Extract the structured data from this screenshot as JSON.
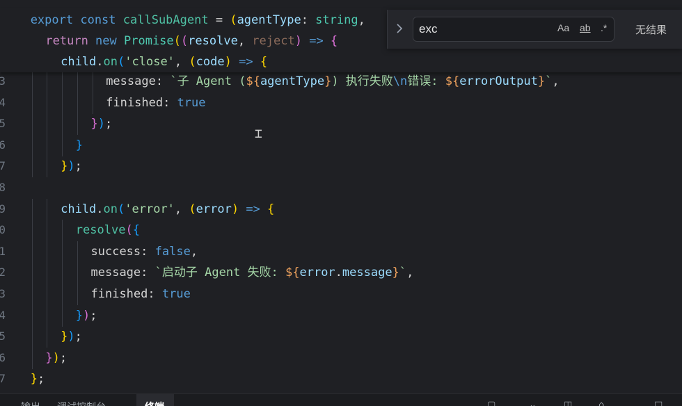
{
  "sticky": [
    {
      "indent": 2,
      "tokens": [
        {
          "t": "export ",
          "c": "kw2"
        },
        {
          "t": "const ",
          "c": "kw2"
        },
        {
          "t": "callSubAgent",
          "c": "fn"
        },
        {
          "t": " = ",
          "c": "plain"
        },
        {
          "t": "(",
          "c": "b1"
        },
        {
          "t": "agentType",
          "c": "var"
        },
        {
          "t": ": ",
          "c": "plain"
        },
        {
          "t": "string",
          "c": "type"
        },
        {
          "t": ",",
          "c": "plain"
        }
      ]
    },
    {
      "indent": 3,
      "tokens": [
        {
          "t": "return ",
          "c": "kw"
        },
        {
          "t": "new ",
          "c": "kw2"
        },
        {
          "t": "Promise",
          "c": "type"
        },
        {
          "t": "(",
          "c": "b1"
        },
        {
          "t": "(",
          "c": "b2"
        },
        {
          "t": "resolve",
          "c": "var"
        },
        {
          "t": ", ",
          "c": "plain"
        },
        {
          "t": "reject",
          "c": "dim"
        },
        {
          "t": ") ",
          "c": "b2"
        },
        {
          "t": "=> ",
          "c": "kw2"
        },
        {
          "t": "{",
          "c": "b2"
        }
      ]
    },
    {
      "indent": 4,
      "tokens": [
        {
          "t": "child",
          "c": "var"
        },
        {
          "t": ".",
          "c": "plain"
        },
        {
          "t": "on",
          "c": "fn"
        },
        {
          "t": "(",
          "c": "b3"
        },
        {
          "t": "'close'",
          "c": "strc"
        },
        {
          "t": ", ",
          "c": "plain"
        },
        {
          "t": "(",
          "c": "b1"
        },
        {
          "t": "code",
          "c": "var"
        },
        {
          "t": ") ",
          "c": "b1"
        },
        {
          "t": "=> ",
          "c": "kw2"
        },
        {
          "t": "{",
          "c": "b1"
        }
      ]
    }
  ],
  "lines": [
    {
      "no": "3",
      "indent": 7,
      "tokens": [
        {
          "t": "message",
          "c": "prop"
        },
        {
          "t": ": ",
          "c": "plain"
        },
        {
          "t": "`子 Agent (",
          "c": "strc"
        },
        {
          "t": "${",
          "c": "tmpl"
        },
        {
          "t": "agentType",
          "c": "var"
        },
        {
          "t": "}",
          "c": "tmpl"
        },
        {
          "t": ") 执行失败",
          "c": "strc"
        },
        {
          "t": "\\n",
          "c": "kw2"
        },
        {
          "t": "错误: ",
          "c": "strc"
        },
        {
          "t": "${",
          "c": "tmpl"
        },
        {
          "t": "errorOutput",
          "c": "var"
        },
        {
          "t": "}",
          "c": "tmpl"
        },
        {
          "t": "`",
          "c": "strc"
        },
        {
          "t": ",",
          "c": "plain"
        }
      ]
    },
    {
      "no": "4",
      "indent": 7,
      "tokens": [
        {
          "t": "finished",
          "c": "prop"
        },
        {
          "t": ": ",
          "c": "plain"
        },
        {
          "t": "true",
          "c": "bool"
        }
      ]
    },
    {
      "no": "5",
      "indent": 6,
      "tokens": [
        {
          "t": "}",
          "c": "b2"
        },
        {
          "t": ")",
          "c": "b3"
        },
        {
          "t": ";",
          "c": "plain"
        }
      ]
    },
    {
      "no": "6",
      "indent": 5,
      "tokens": [
        {
          "t": "}",
          "c": "b3"
        }
      ]
    },
    {
      "no": "7",
      "indent": 4,
      "tokens": [
        {
          "t": "}",
          "c": "b1"
        },
        {
          "t": ")",
          "c": "b3"
        },
        {
          "t": ";",
          "c": "plain"
        }
      ]
    },
    {
      "no": "8",
      "indent": 0,
      "tokens": []
    },
    {
      "no": "9",
      "indent": 4,
      "tokens": [
        {
          "t": "child",
          "c": "var"
        },
        {
          "t": ".",
          "c": "plain"
        },
        {
          "t": "on",
          "c": "fn"
        },
        {
          "t": "(",
          "c": "b3"
        },
        {
          "t": "'error'",
          "c": "strc"
        },
        {
          "t": ", ",
          "c": "plain"
        },
        {
          "t": "(",
          "c": "b1"
        },
        {
          "t": "error",
          "c": "var"
        },
        {
          "t": ") ",
          "c": "b1"
        },
        {
          "t": "=> ",
          "c": "kw2"
        },
        {
          "t": "{",
          "c": "b1"
        }
      ]
    },
    {
      "no": "0",
      "indent": 5,
      "tokens": [
        {
          "t": "resolve",
          "c": "fn"
        },
        {
          "t": "(",
          "c": "b2"
        },
        {
          "t": "{",
          "c": "b3"
        }
      ]
    },
    {
      "no": "1",
      "indent": 6,
      "tokens": [
        {
          "t": "success",
          "c": "prop"
        },
        {
          "t": ": ",
          "c": "plain"
        },
        {
          "t": "false",
          "c": "bool"
        },
        {
          "t": ",",
          "c": "plain"
        }
      ]
    },
    {
      "no": "2",
      "indent": 6,
      "tokens": [
        {
          "t": "message",
          "c": "prop"
        },
        {
          "t": ": ",
          "c": "plain"
        },
        {
          "t": "`启动子 Agent 失败: ",
          "c": "strc"
        },
        {
          "t": "${",
          "c": "tmpl"
        },
        {
          "t": "error",
          "c": "var"
        },
        {
          "t": ".",
          "c": "plain"
        },
        {
          "t": "message",
          "c": "var"
        },
        {
          "t": "}",
          "c": "tmpl"
        },
        {
          "t": "`",
          "c": "strc"
        },
        {
          "t": ",",
          "c": "plain"
        }
      ]
    },
    {
      "no": "3",
      "indent": 6,
      "tokens": [
        {
          "t": "finished",
          "c": "prop"
        },
        {
          "t": ": ",
          "c": "plain"
        },
        {
          "t": "true",
          "c": "bool"
        }
      ]
    },
    {
      "no": "4",
      "indent": 5,
      "tokens": [
        {
          "t": "}",
          "c": "b3"
        },
        {
          "t": ")",
          "c": "b2"
        },
        {
          "t": ";",
          "c": "plain"
        }
      ]
    },
    {
      "no": "5",
      "indent": 4,
      "tokens": [
        {
          "t": "}",
          "c": "b1"
        },
        {
          "t": ")",
          "c": "b3"
        },
        {
          "t": ";",
          "c": "plain"
        }
      ]
    },
    {
      "no": "6",
      "indent": 3,
      "tokens": [
        {
          "t": "}",
          "c": "b2"
        },
        {
          "t": ")",
          "c": "b1"
        },
        {
          "t": ";",
          "c": "plain"
        }
      ]
    },
    {
      "no": "7",
      "indent": 2,
      "tokens": [
        {
          "t": "}",
          "c": "b1"
        },
        {
          "t": ";",
          "c": "plain"
        }
      ]
    }
  ],
  "find": {
    "query": "exc",
    "toggle_icon": "chevron-right-icon",
    "match_case": "Aa",
    "whole_word": "ab",
    "regex": ".*",
    "result": "无结果"
  },
  "panel": {
    "tabs": [
      "输出",
      "调试控制台",
      "终端"
    ],
    "active_tab": "终端"
  }
}
